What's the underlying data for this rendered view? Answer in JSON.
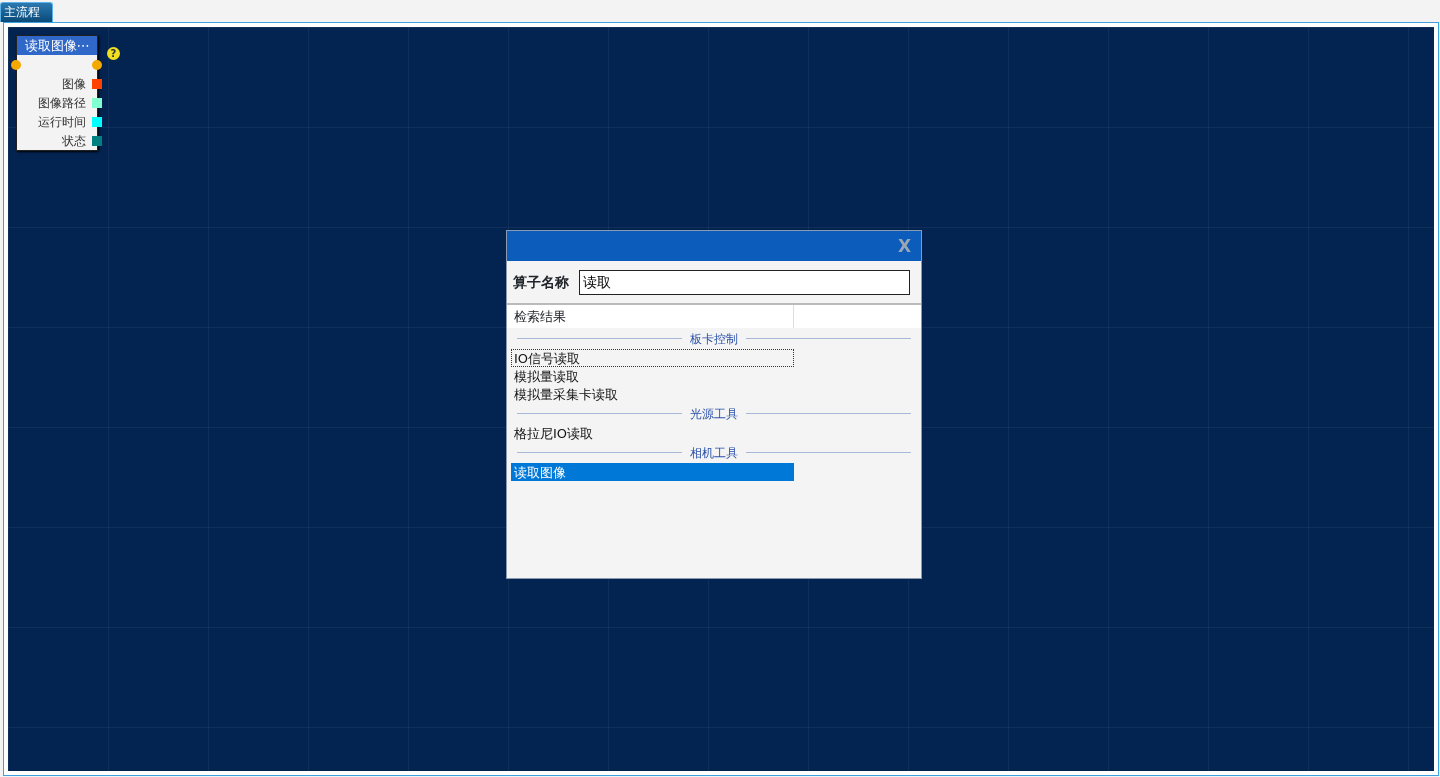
{
  "tabs": [
    {
      "label": "主流程",
      "selected": true
    }
  ],
  "node": {
    "title": "读取图像⋯",
    "help": "?",
    "ports": [
      {
        "label": "图像",
        "color": "#ff4000"
      },
      {
        "label": "图像路径",
        "color": "#80ffd0"
      },
      {
        "label": "运行时间",
        "color": "#00ffff"
      },
      {
        "label": "状态",
        "color": "#008080"
      }
    ]
  },
  "dialog": {
    "close": "X",
    "field_label": "算子名称",
    "field_value": "读取",
    "results_header": "检索结果",
    "groups": [
      {
        "title": "板卡控制",
        "items": [
          {
            "label": "IO信号读取",
            "selected": false,
            "focused": true
          },
          {
            "label": "模拟量读取",
            "selected": false,
            "focused": false
          },
          {
            "label": "模拟量采集卡读取",
            "selected": false,
            "focused": false
          }
        ]
      },
      {
        "title": "光源工具",
        "items": [
          {
            "label": "格拉尼IO读取",
            "selected": false,
            "focused": false
          }
        ]
      },
      {
        "title": "相机工具",
        "items": [
          {
            "label": "读取图像",
            "selected": true,
            "focused": false
          }
        ]
      }
    ]
  }
}
